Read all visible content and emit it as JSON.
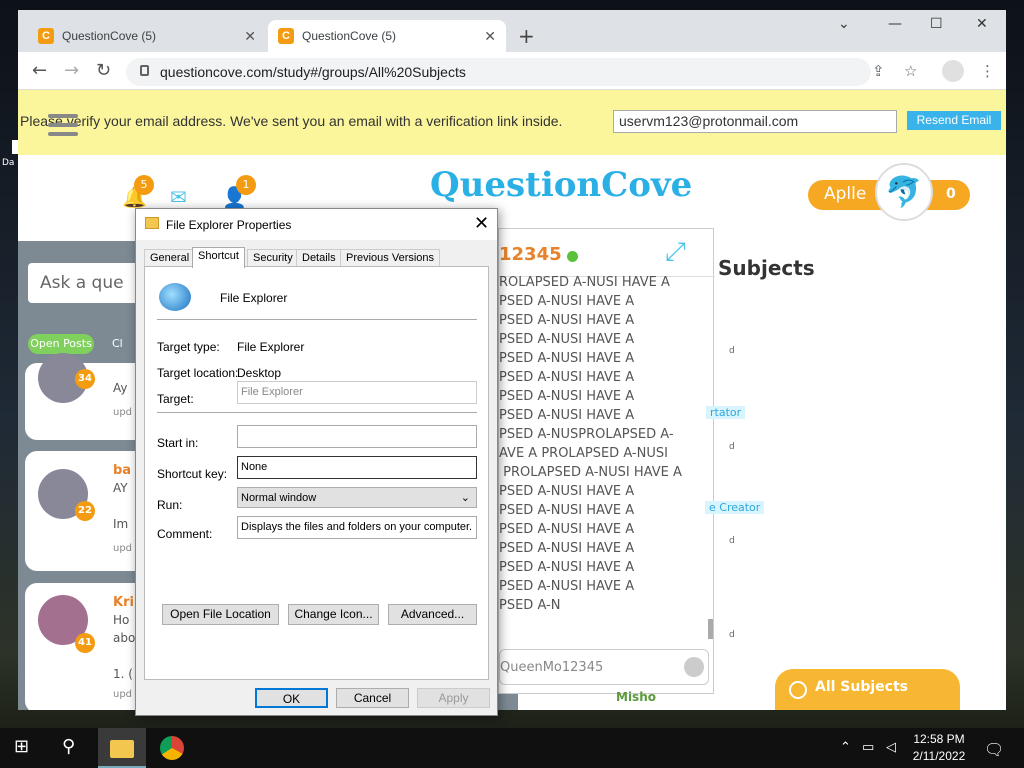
{
  "browser": {
    "tabs": [
      {
        "title": "QuestionCove (5)",
        "favicon": "C"
      },
      {
        "title": "QuestionCove (5)",
        "favicon": "C"
      }
    ],
    "url": "questioncove.com/study#/groups/All%20Subjects"
  },
  "site": {
    "verify_msg": "Please verify your email address. We've sent you an email with a verification link inside.",
    "email": "uservm123@protonmail.com",
    "resend_label": "Resend Email",
    "logo": "QuestionCove",
    "notif_count": "5",
    "friends_count": "1",
    "username": "Aplle",
    "points": "0",
    "ask_placeholder": "Ask a que",
    "open_posts": "Open Posts",
    "other_pill": "Cl",
    "subjects_title": "Subjects",
    "all_subjects": "All Subjects",
    "misho": "Misho",
    "tag1": "rtator",
    "tag2": "e Creator",
    "small_d": "d"
  },
  "posts": [
    {
      "badge": "34",
      "text": "Ay",
      "meta": "upd"
    },
    {
      "badge": "22",
      "name": "ba",
      "text": "AY",
      "text2": "Im",
      "meta": "upd"
    },
    {
      "badge": "41",
      "name": "Kri",
      "text": "Ho",
      "text2": "abo",
      "text3": "1. (",
      "meta": "upd"
    }
  ],
  "chat": {
    "name": "12345",
    "lines": "ROLAPSED A-NUSI HAVE A\nPSED A-NUSI HAVE A\nPSED A-NUSI HAVE A\nPSED A-NUSI HAVE A\nPSED A-NUSI HAVE A\nPSED A-NUSI HAVE A\nPSED A-NUSI HAVE A\nPSED A-NUSI HAVE A\nPSED A-NUSPROLAPSED A-\nAVE A PROLAPSED A-NUSI\n PROLAPSED A-NUSI HAVE A\nPSED A-NUSI HAVE A\nPSED A-NUSI HAVE A\nPSED A-NUSI HAVE A\nPSED A-NUSI HAVE A\nPSED A-NUSI HAVE A\nPSED A-NUSI HAVE A\nPSED A-N",
    "input_placeholder": "QueenMo12345"
  },
  "dialog": {
    "title": "File Explorer Properties",
    "tabs": [
      "General",
      "Shortcut",
      "Security",
      "Details",
      "Previous Versions"
    ],
    "name": "File Explorer",
    "target_type_label": "Target type:",
    "target_type": "File Explorer",
    "target_location_label": "Target location:",
    "target_location": "Desktop",
    "target_label": "Target:",
    "target": "File Explorer",
    "start_in_label": "Start in:",
    "start_in": "",
    "shortcut_key_label": "Shortcut key:",
    "shortcut_key": "None",
    "run_label": "Run:",
    "run": "Normal window",
    "comment_label": "Comment:",
    "comment": "Displays the files and folders on your computer.",
    "open_file_location": "Open File Location",
    "change_icon": "Change Icon...",
    "advanced": "Advanced...",
    "ok": "OK",
    "cancel": "Cancel",
    "apply": "Apply"
  },
  "taskbar": {
    "time": "12:58 PM",
    "date": "2/11/2022"
  },
  "desktop": {
    "label": "Da"
  }
}
